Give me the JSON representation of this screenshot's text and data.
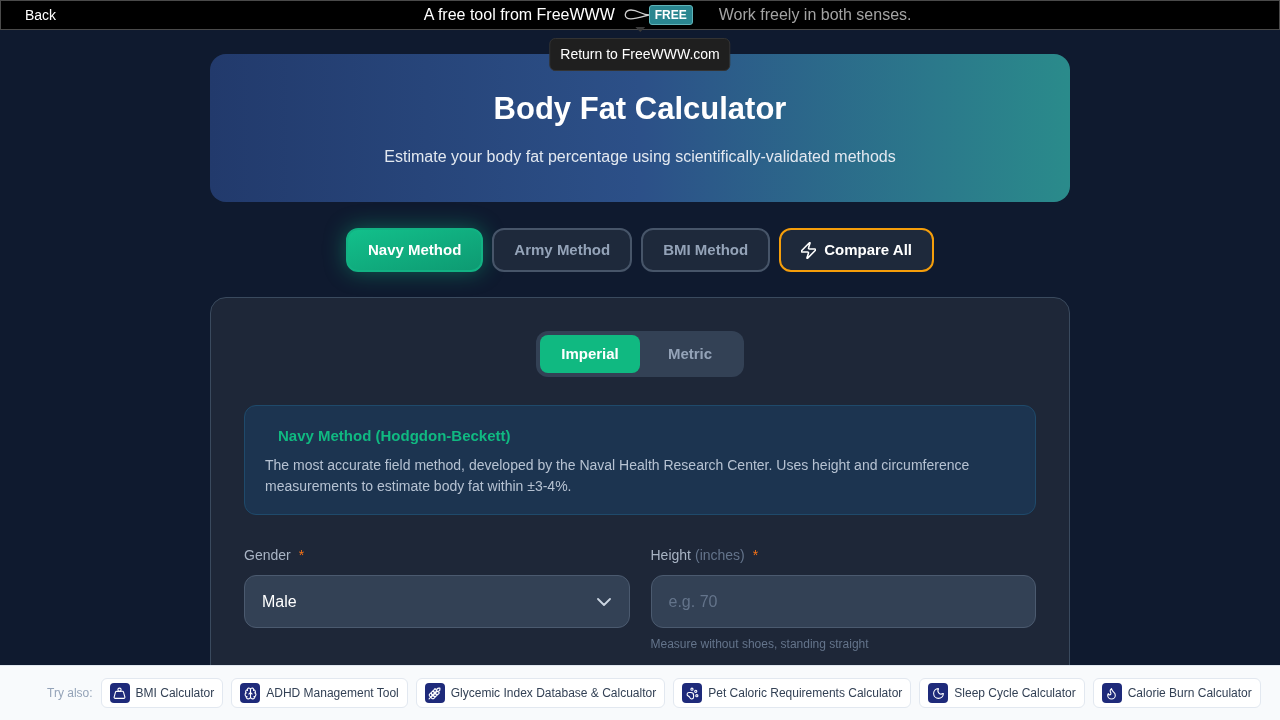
{
  "top_bar": {
    "back": "Back",
    "tagline": "A free tool from FreeWWW",
    "logo_text": "FREE",
    "motto": "Work freely in both senses.",
    "tooltip": "Return to FreeWWW.com"
  },
  "header": {
    "title": "Body Fat Calculator",
    "subtitle": "Estimate your body fat percentage using scientifically-validated methods"
  },
  "method_tabs": [
    {
      "kind": "method",
      "label": "Navy Method",
      "selected": true
    },
    {
      "kind": "method",
      "label": "Army Method",
      "selected": false
    },
    {
      "kind": "method",
      "label": "BMI Method",
      "selected": false
    },
    {
      "kind": "compare",
      "label": "Compare All",
      "selected": false
    }
  ],
  "unit_toggle": [
    {
      "label": "Imperial",
      "selected": true
    },
    {
      "label": "Metric",
      "selected": false
    }
  ],
  "info_box": {
    "title": "Navy Method (Hodgdon-Beckett)",
    "text": "The most accurate field method, developed by the Naval Health Research Center. Uses height and circumference measurements to estimate body fat within ±3-4%."
  },
  "fields": [
    {
      "kind": "select",
      "label": "Gender",
      "required_mark": "*",
      "value": "Male"
    },
    {
      "kind": "input",
      "label": "Height",
      "unit": "(inches)",
      "required_mark": "*",
      "placeholder": "e.g. 70",
      "hint": "Measure without shoes, standing straight"
    }
  ],
  "footer": {
    "label": "Try also:",
    "links": [
      {
        "label": "BMI Calculator"
      },
      {
        "label": "ADHD Management Tool"
      },
      {
        "label": "Glycemic Index Database & Calcualtor"
      },
      {
        "label": "Pet Caloric Requirements Calculator"
      },
      {
        "label": "Sleep Cycle Calculator"
      },
      {
        "label": "Calorie Burn Calculator"
      }
    ]
  }
}
